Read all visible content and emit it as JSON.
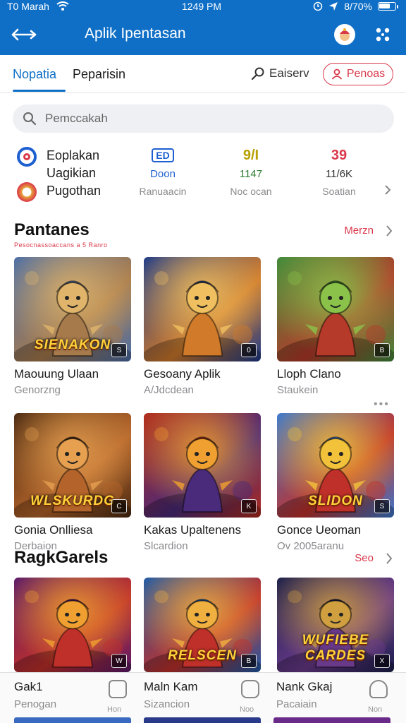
{
  "status_bar": {
    "carrier": "T0 Marah",
    "time": "1249 PM",
    "battery": "8/70%",
    "battery_level": 0.7
  },
  "header": {
    "title": "Aplik Ipentasan"
  },
  "tabs": [
    {
      "label": "Nopatia",
      "active": true
    },
    {
      "label": "Peparisin",
      "active": false
    }
  ],
  "tab_search_label": "Eaiserv",
  "action_button_label": "Penoas",
  "search": {
    "placeholder": "Pemccakah"
  },
  "stats": {
    "left_labels": [
      "Eoplakan",
      "Uagikian",
      "Pugothan"
    ],
    "columns": [
      {
        "badge": "ED",
        "value": "Doon",
        "label": "Ranuaacin",
        "color": "#1e5fd1"
      },
      {
        "badge": "9/I",
        "value": "1147",
        "label": "Noc ocan",
        "color": "#b7a000"
      },
      {
        "badge": "39",
        "value": "11/6K",
        "label": "Soatian",
        "color": "#d9384a"
      }
    ]
  },
  "sections": [
    {
      "title": "Pantanes",
      "subtitle": "Pesocnassoaccans a 5 Ranro",
      "link": "Merzn",
      "cards": [
        {
          "title": "Maouung Ulaan",
          "subtitle": "Genorzng",
          "overlay": "SIENAKON",
          "corner": "S",
          "icon": "armored-warrior-art",
          "palette": [
            "#4b6fa8",
            "#a77a4c",
            "#e0b46a"
          ]
        },
        {
          "title": "Gesoany Aplik",
          "subtitle": "A/Jdcdean",
          "overlay": "",
          "corner": "0",
          "icon": "fox-hero-art",
          "palette": [
            "#1c3a8a",
            "#d07a2a",
            "#f0c060"
          ]
        },
        {
          "title": "Lloph Clano",
          "subtitle": "Staukein",
          "overlay": "",
          "corner": "B",
          "icon": "red-brawler-art",
          "palette": [
            "#3f8a3a",
            "#b53a2a",
            "#8bc34a"
          ]
        }
      ]
    },
    {
      "title": "",
      "subtitle": "",
      "link": "",
      "cards": [
        {
          "title": "Gonia Onlliesa",
          "subtitle": "Derbaion",
          "overlay": "WLSKURDG",
          "corner": "C",
          "icon": "gunslinger-art",
          "palette": [
            "#4a2a12",
            "#b4642a",
            "#e6a050"
          ]
        },
        {
          "title": "Kakas Upaltenens",
          "subtitle": "Slcardion",
          "overlay": "",
          "corner": "K",
          "icon": "hero-squad-art",
          "palette": [
            "#b02a1a",
            "#4a2a7a",
            "#f0a030"
          ]
        },
        {
          "title": "Gonce Ueoman",
          "subtitle": "Ov 2005aranu",
          "overlay": "SLIDON",
          "corner": "S",
          "icon": "caped-hero-art",
          "palette": [
            "#3a7ad0",
            "#c0302a",
            "#f2c23a"
          ]
        }
      ]
    },
    {
      "title": "RagkGarels",
      "subtitle": "",
      "link": "Seo",
      "cards": [
        {
          "title": "",
          "subtitle": "",
          "overlay": "",
          "corner": "W",
          "icon": "sorceress-art",
          "palette": [
            "#5a1a6a",
            "#c0302a",
            "#f0a030"
          ]
        },
        {
          "title": "",
          "subtitle": "",
          "overlay": "RELSCEN",
          "corner": "B",
          "icon": "party-battle-art",
          "palette": [
            "#1c5aa8",
            "#c0302a",
            "#f0b040"
          ]
        },
        {
          "title": "",
          "subtitle": "",
          "overlay": "WUFIEBE CARDES",
          "corner": "X",
          "icon": "dark-knight-art",
          "palette": [
            "#1a1f4a",
            "#6a3a8a",
            "#d0a040"
          ]
        }
      ]
    }
  ],
  "bottom_bar": [
    {
      "title": "Gak1",
      "subtitle": "Penogan",
      "icon_label": "Hon"
    },
    {
      "title": "Maln Kam",
      "subtitle": "Sizancion",
      "icon_label": "Noo"
    },
    {
      "title": "Nank Gkaj",
      "subtitle": "Pacaiain",
      "icon_label": "Non"
    }
  ],
  "colors": {
    "primary": "#0f6fc6",
    "accent": "#d9384a",
    "muted": "#8a8a8e"
  }
}
